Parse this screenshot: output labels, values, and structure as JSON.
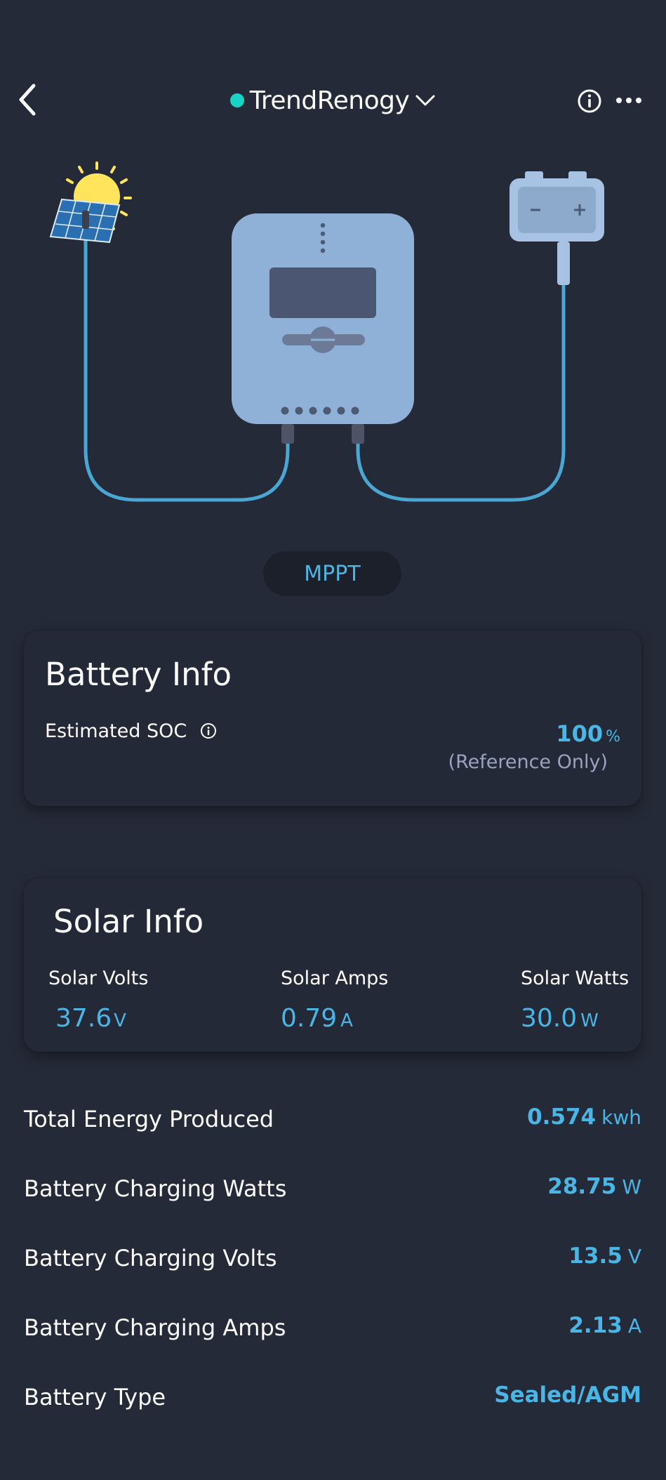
{
  "header": {
    "title": "TrendRenogy",
    "status_color": "#19d3c5"
  },
  "mode": "MPPT",
  "battery_info": {
    "title": "Battery Info",
    "soc_label": "Estimated SOC",
    "soc_value": "100",
    "soc_unit": "%",
    "soc_note": "(Reference Only)"
  },
  "solar_info": {
    "title": "Solar Info",
    "metrics": [
      {
        "label": "Solar Volts",
        "value": "37.6",
        "unit": "V"
      },
      {
        "label": "Solar Amps",
        "value": "0.79",
        "unit": "A"
      },
      {
        "label": "Solar Watts",
        "value": "30.0",
        "unit": "W"
      }
    ]
  },
  "stats": [
    {
      "label": "Total Energy Produced",
      "value": "0.574",
      "unit": "kwh"
    },
    {
      "label": "Battery Charging Watts",
      "value": "28.75",
      "unit": "W"
    },
    {
      "label": "Battery Charging Volts",
      "value": "13.5",
      "unit": "V"
    },
    {
      "label": "Battery Charging Amps",
      "value": "2.13",
      "unit": "A"
    },
    {
      "label": "Battery Type",
      "value": "Sealed/AGM",
      "unit": ""
    }
  ],
  "colors": {
    "background": "#252a38",
    "accent": "#4ab6e6",
    "muted": "#9aa3bf",
    "controller": "#8fb1d8",
    "cable": "#4aa7d4",
    "sun": "#ffe45c"
  },
  "icons": {
    "back": "chevron-left-icon",
    "dropdown": "chevron-down-icon",
    "info": "info-icon",
    "more": "more-horizontal-icon"
  }
}
